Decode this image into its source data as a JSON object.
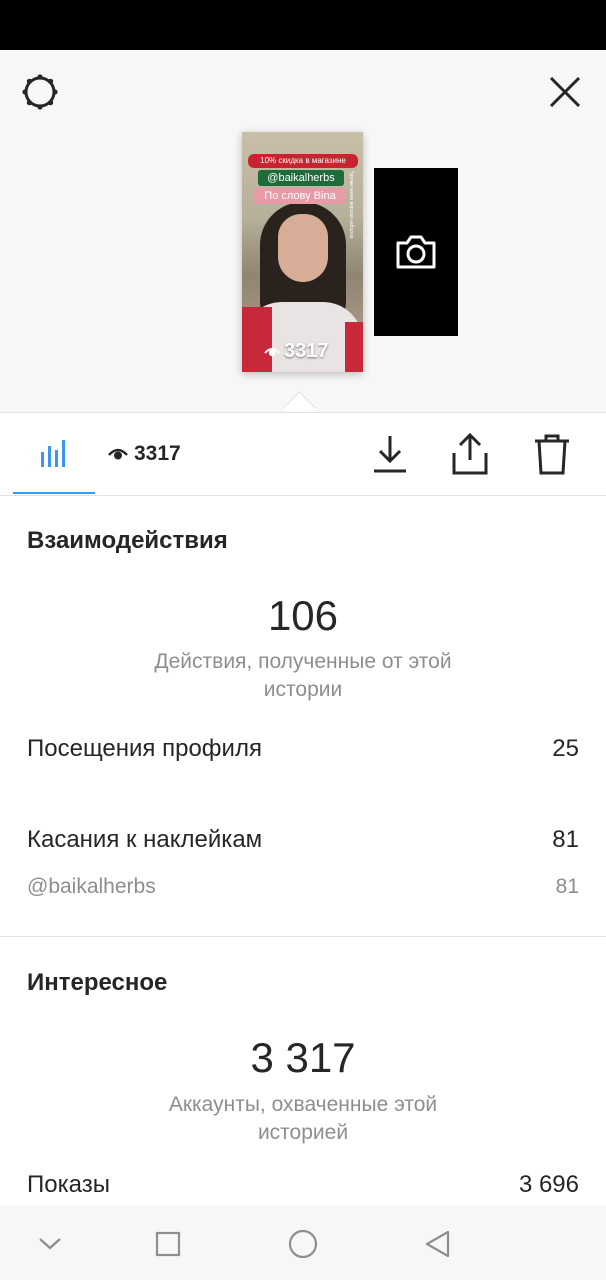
{
  "story": {
    "promo_sticker": "10% скидка в магазине",
    "handle_sticker": "@baikalherbs",
    "word_sticker": "По слову Bina",
    "side_caption": "*кроме мини версии наборов",
    "view_count": "3317"
  },
  "tabs": {
    "views": "3317"
  },
  "interactions": {
    "title": "Взаимодействия",
    "total": "106",
    "caption": "Действия, полученные от этой истории",
    "rows": [
      {
        "label": "Посещения профиля",
        "value": "25"
      },
      {
        "label": "Касания к наклейкам",
        "value": "81"
      }
    ],
    "sub_rows": [
      {
        "label": "@baikalherbs",
        "value": "81"
      }
    ]
  },
  "discovery": {
    "title": "Интересное",
    "total": "3 317",
    "caption": "Аккаунты, охваченные этой историей",
    "rows": [
      {
        "label": "Показы",
        "value": "3 696"
      }
    ]
  },
  "icons": {
    "settings": "gear-icon",
    "close": "close-icon",
    "camera": "camera-icon",
    "insights": "bar-chart-icon",
    "views": "eye-icon",
    "download": "download-icon",
    "share": "share-icon",
    "delete": "trash-icon",
    "nav_down": "chevron-down-icon",
    "nav_recents": "square-icon",
    "nav_home": "circle-icon",
    "nav_back": "triangle-back-icon"
  },
  "colors": {
    "accent": "#3897f0",
    "text": "#262626",
    "secondary_text": "#8e8e8e",
    "panel_bg": "#f7f7f7"
  }
}
